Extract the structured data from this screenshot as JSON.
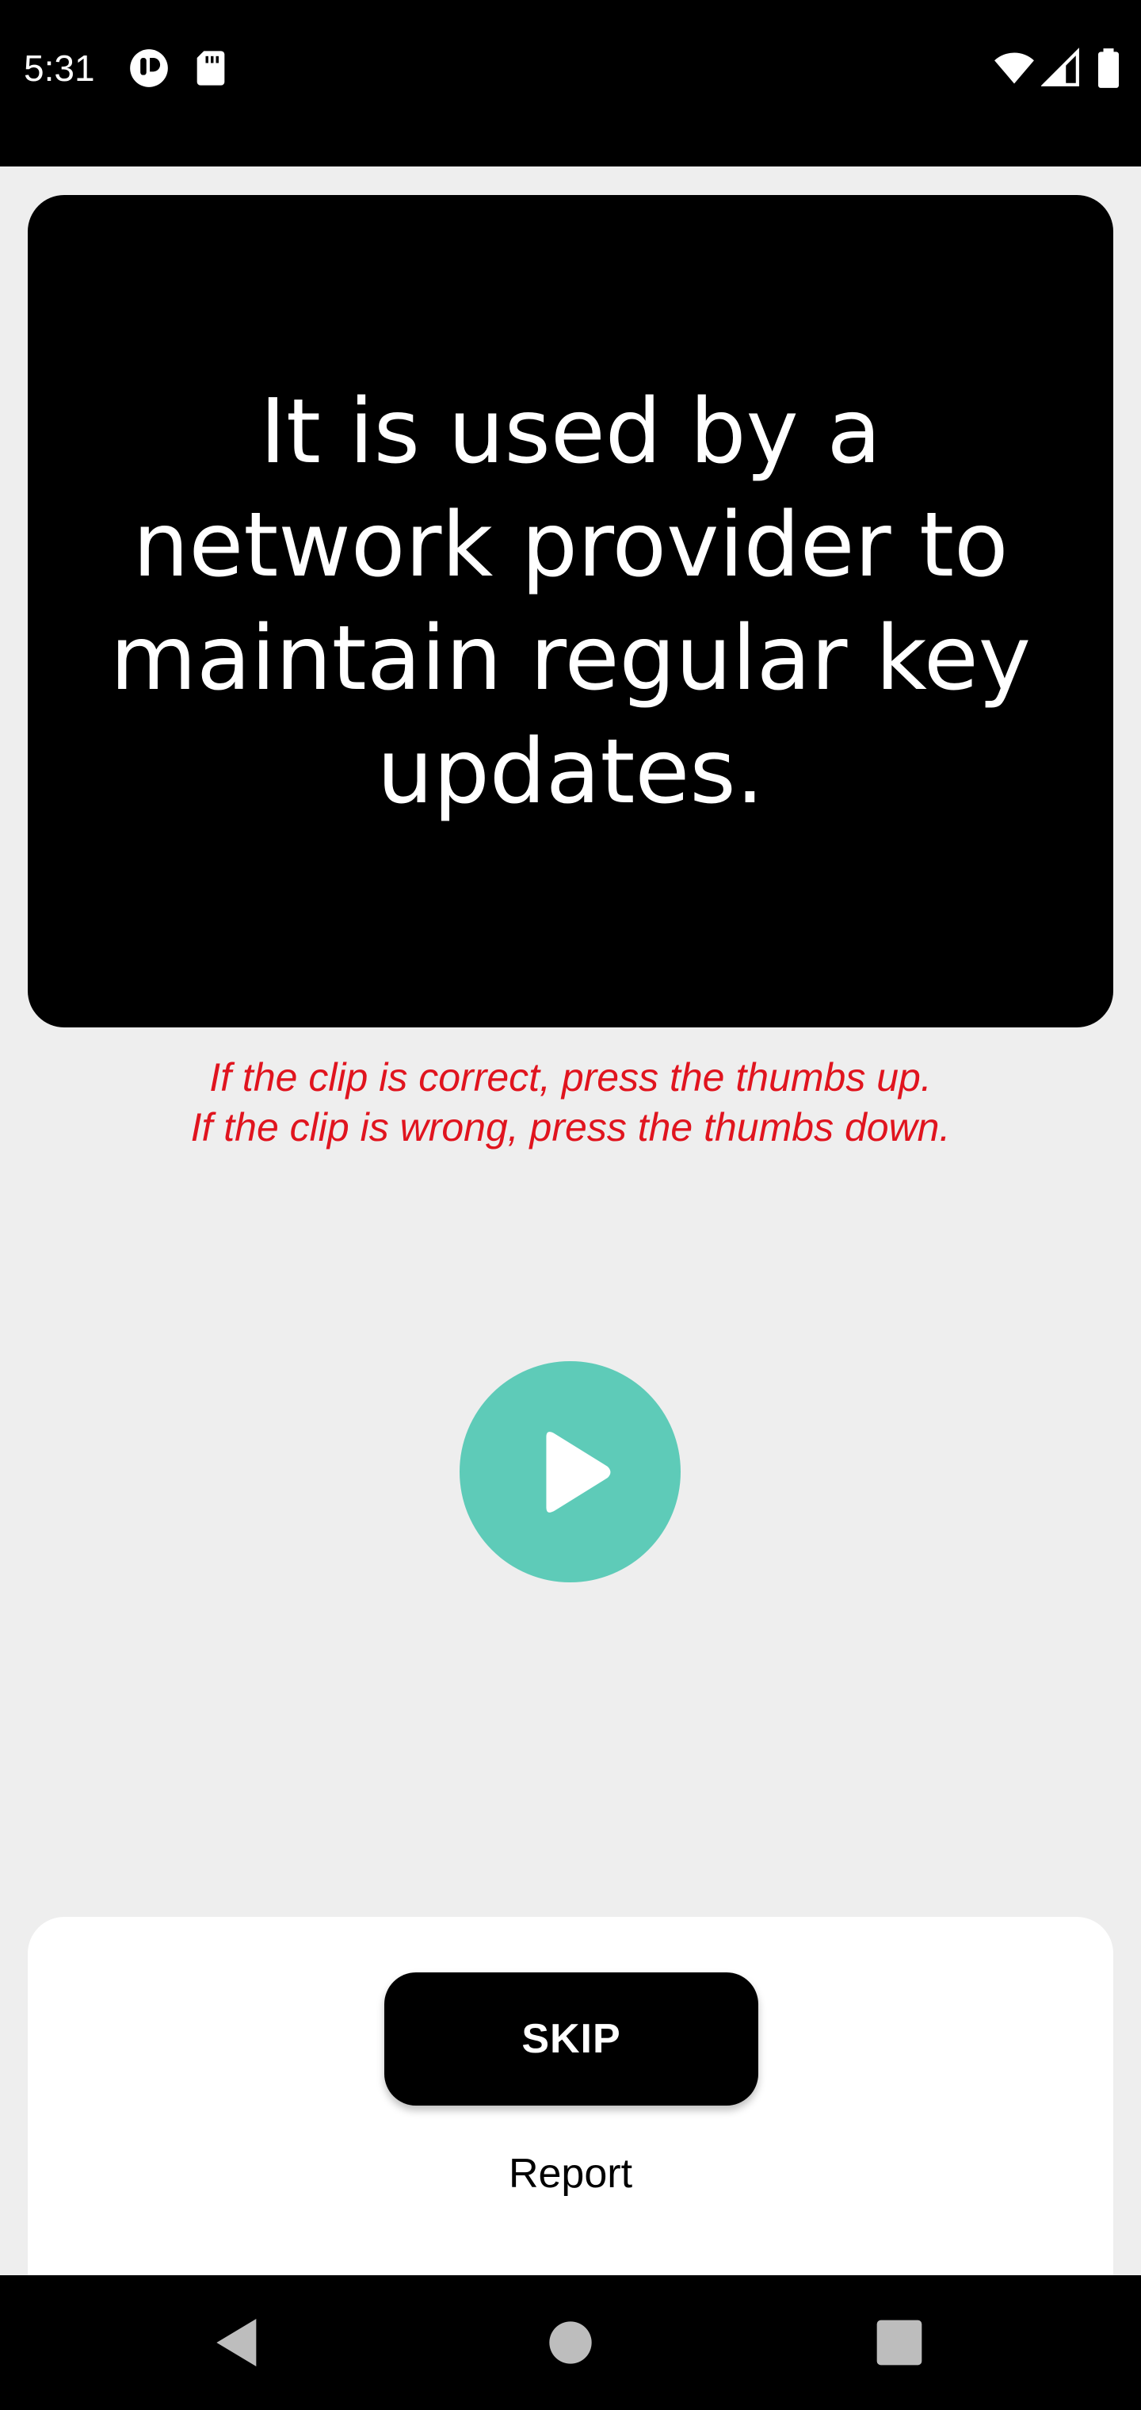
{
  "status_bar": {
    "time": "5:31",
    "icons_left": [
      "dnd-icon",
      "sd-card-icon"
    ],
    "icons_right": [
      "wifi-icon",
      "cell-signal-icon",
      "battery-icon"
    ]
  },
  "card": {
    "sentence": "It is used by a network provider to maintain regular key updates."
  },
  "instructions": {
    "line1": "If the clip is correct, press the thumbs up.",
    "line2": "If the clip is wrong, press the thumbs down."
  },
  "player": {
    "icon": "play-icon",
    "color": "#5ecbb8"
  },
  "actions": {
    "skip_label": "SKIP",
    "report_label": "Report"
  },
  "nav_bar": {
    "buttons": [
      "back-icon",
      "home-icon",
      "recents-icon"
    ]
  },
  "colors": {
    "instruction_text": "#e0141e",
    "background": "#eeeeee",
    "card": "#000000"
  }
}
